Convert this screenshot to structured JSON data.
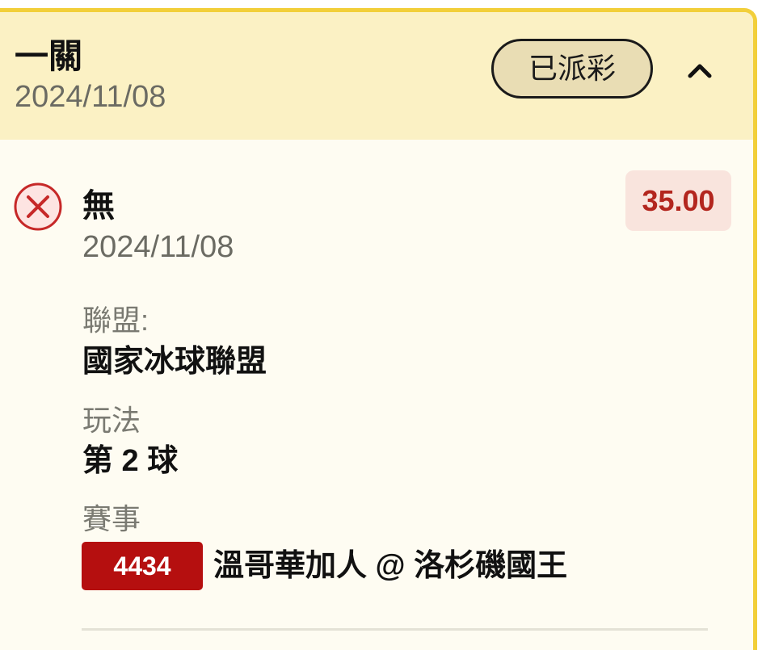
{
  "header": {
    "bet_type": "一關",
    "date": "2024/11/08",
    "status": "已派彩",
    "toggle_icon": "chevron-up-icon"
  },
  "leg": {
    "result_icon": "x-circle-icon",
    "result_color": "#c62828",
    "selection": "無",
    "date": "2024/11/08",
    "odds": "35.00",
    "fields": [
      {
        "label": "聯盟:",
        "value": "國家冰球聯盟"
      },
      {
        "label": "玩法",
        "value": "第 2 球"
      },
      {
        "label": "賽事",
        "value": ""
      }
    ],
    "event": {
      "id": "4434",
      "teams": "溫哥華加人 @ 洛杉磯國王"
    }
  },
  "colors": {
    "card_border": "#f2cf3a",
    "header_bg": "#fbf1c4",
    "body_bg": "#fefcf2",
    "status_pill_bg": "#e9ddb4",
    "odds_text": "#b3261e",
    "odds_bg": "#f9e4dd",
    "event_id_bg": "#b50f0f"
  }
}
